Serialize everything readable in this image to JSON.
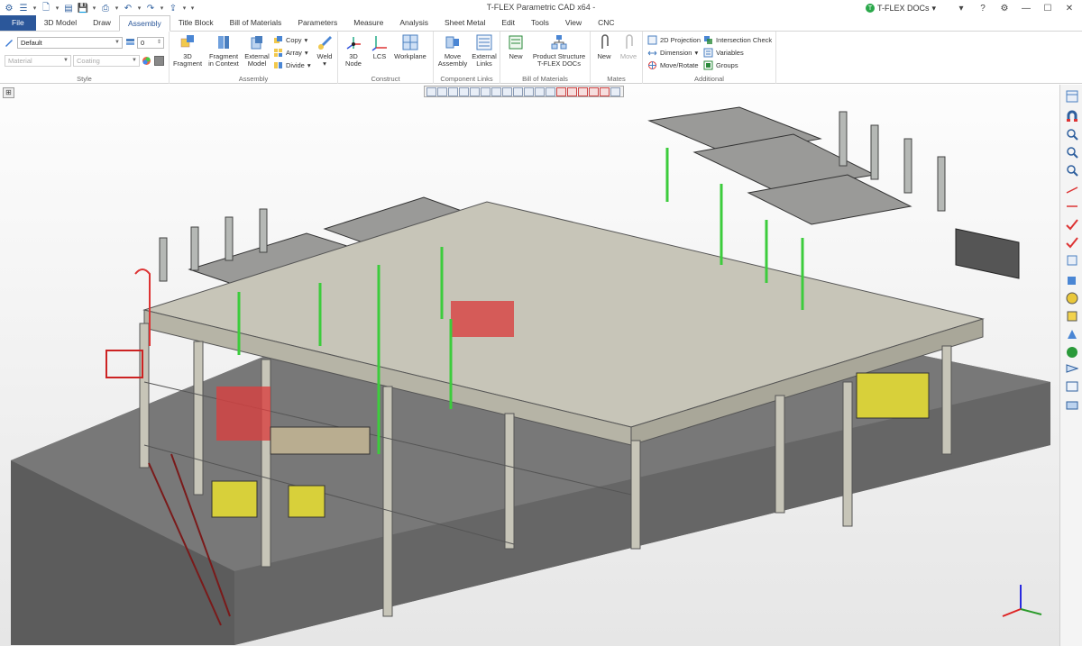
{
  "app": {
    "title": "T-FLEX Parametric CAD x64 -",
    "docs_label": "T-FLEX DOCs"
  },
  "tabs": [
    "File",
    "3D Model",
    "Draw",
    "Assembly",
    "Title Block",
    "Bill of Materials",
    "Parameters",
    "Measure",
    "Analysis",
    "Sheet Metal",
    "Edit",
    "Tools",
    "View",
    "CNC"
  ],
  "active_tab": "Assembly",
  "style_group": {
    "label": "Style",
    "style_value": "Default",
    "layer_value": "0",
    "material_placeholder": "Material",
    "coating_placeholder": "Coating"
  },
  "assembly_group": {
    "label": "Assembly",
    "fragment_3d": "3D\nFragment",
    "fragment_context": "Fragment\nin Context",
    "external_model": "External\nModel",
    "copy": "Copy",
    "array": "Array",
    "divide": "Divide",
    "weld": "Weld"
  },
  "construct_group": {
    "label": "Construct",
    "node_3d": "3D\nNode",
    "lcs": "LCS",
    "workplane": "Workplane"
  },
  "component_links_group": {
    "label": "Component Links",
    "move_assembly": "Move\nAssembly",
    "external_links": "External\nLinks"
  },
  "bom_group": {
    "label": "Bill of Materials",
    "new": "New",
    "product_structure": "Product Structure\nT-FLEX DOCs"
  },
  "mates_group": {
    "label": "Mates",
    "new": "New",
    "move": "Move"
  },
  "additional_group": {
    "label": "Additional",
    "projection_2d": "2D Projection",
    "dimension": "Dimension",
    "move_rotate": "Move/Rotate",
    "intersection_check": "Intersection Check",
    "variables": "Variables",
    "groups": "Groups"
  },
  "colors": {
    "accent": "#2b579a",
    "frame": "#c7c5b8",
    "floor": "#6a6a6a",
    "pipe_green": "#3ccc3c",
    "equipment_yellow": "#d8d03a",
    "accent_red": "#d03a3a"
  }
}
